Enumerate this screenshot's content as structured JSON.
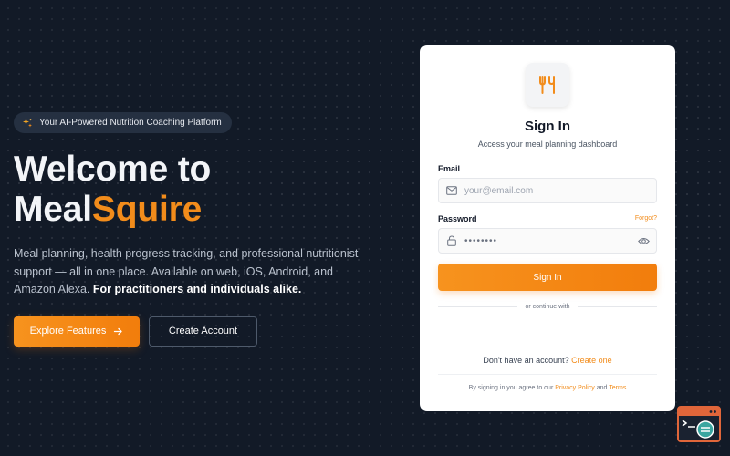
{
  "badge": {
    "text": "Your AI-Powered Nutrition Coaching Platform",
    "icon": "sparkles-icon"
  },
  "hero": {
    "headline_line1": "Welcome to",
    "headline_brand_a": "Meal",
    "headline_brand_b": "Squire",
    "description": "Meal planning, health progress tracking, and professional nutritionist support — all in one place. Available on web, iOS, Android, and Amazon Alexa.",
    "description_emphasis": "For practitioners and individuals alike.",
    "primary_cta": "Explore Features",
    "secondary_cta": "Create Account"
  },
  "signin": {
    "title": "Sign In",
    "subtitle": "Access your meal planning dashboard",
    "email_label": "Email",
    "email_placeholder": "your@email.com",
    "password_label": "Password",
    "forgot": "Forgot?",
    "password_mask": "••••••••",
    "button": "Sign In",
    "divider": "or continue with",
    "no_account": "Don't have an account?",
    "create_link": "Create one",
    "terms_prefix": "By signing in you agree to our",
    "privacy_link": "Privacy Policy",
    "terms_and": "and",
    "terms_link": "Terms"
  },
  "colors": {
    "accent": "#f28c1b",
    "background": "#121a27",
    "card": "#ffffff"
  }
}
